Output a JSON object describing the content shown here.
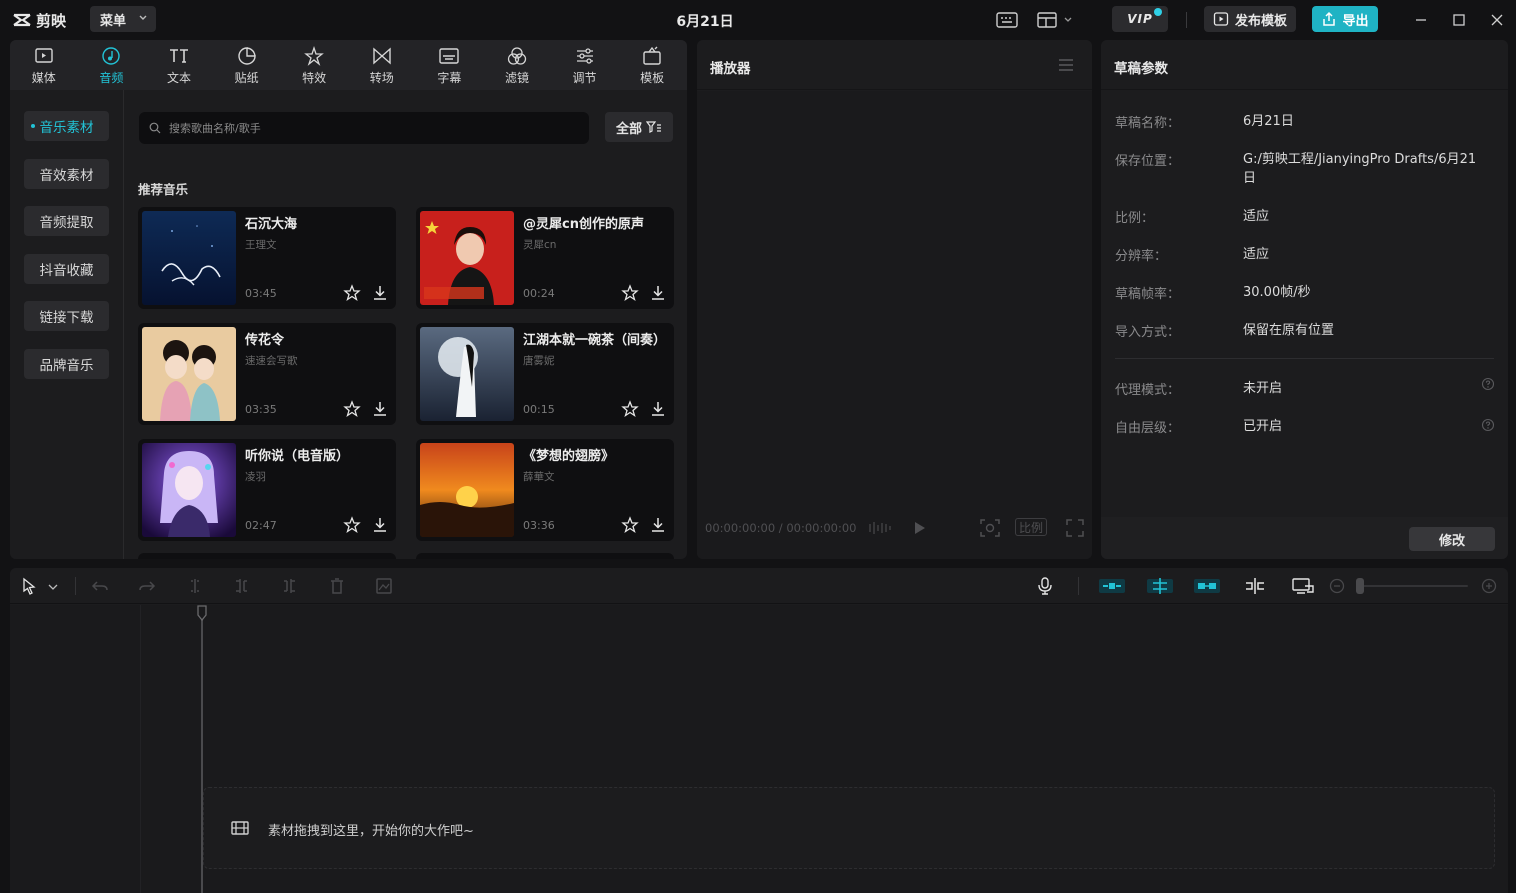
{
  "app": {
    "name": "剪映",
    "menu_label": "菜单",
    "window_title": "6月21日",
    "vip_label": "VIP",
    "publish_label": "发布模板",
    "export_label": "导出"
  },
  "categories": [
    {
      "label": "媒体",
      "icon": "media-icon",
      "active": false
    },
    {
      "label": "音频",
      "icon": "audio-icon",
      "active": true
    },
    {
      "label": "文本",
      "icon": "text-icon",
      "active": false
    },
    {
      "label": "贴纸",
      "icon": "sticker-icon",
      "active": false
    },
    {
      "label": "特效",
      "icon": "effects-icon",
      "active": false
    },
    {
      "label": "转场",
      "icon": "transition-icon",
      "active": false
    },
    {
      "label": "字幕",
      "icon": "subtitle-icon",
      "active": false
    },
    {
      "label": "滤镜",
      "icon": "filter-icon",
      "active": false
    },
    {
      "label": "调节",
      "icon": "adjust-icon",
      "active": false
    },
    {
      "label": "模板",
      "icon": "template-icon",
      "active": false
    }
  ],
  "subnav": [
    {
      "label": "音乐素材",
      "active": true
    },
    {
      "label": "音效素材",
      "active": false
    },
    {
      "label": "音频提取",
      "active": false
    },
    {
      "label": "抖音收藏",
      "active": false
    },
    {
      "label": "链接下载",
      "active": false
    },
    {
      "label": "品牌音乐",
      "active": false
    }
  ],
  "search": {
    "placeholder": "搜索歌曲名称/歌手"
  },
  "filter_label": "全部",
  "section_title": "推荐音乐",
  "songs": [
    {
      "title": "石沉大海",
      "artist": "王理文",
      "duration": "03:45"
    },
    {
      "title": "@灵犀cn创作的原声",
      "artist": "灵犀cn",
      "duration": "00:24"
    },
    {
      "title": "传花令",
      "artist": "速速会写歌",
      "duration": "03:35"
    },
    {
      "title": "江湖本就一碗茶（间奏）",
      "artist": "唐雾妮",
      "duration": "00:15"
    },
    {
      "title": "听你说（电音版）",
      "artist": "凌羽",
      "duration": "02:47"
    },
    {
      "title": "《梦想的翅膀》",
      "artist": "薛華文",
      "duration": "03:36"
    }
  ],
  "player": {
    "title": "播放器",
    "timecode": "00:00:00:00 / 00:00:00:00",
    "ratio_label": "比例"
  },
  "draft": {
    "title": "草稿参数",
    "params": [
      {
        "label": "草稿名称：",
        "value": "6月21日"
      },
      {
        "label": "保存位置：",
        "value": "G:/剪映工程/JianyingPro Drafts/6月21日"
      },
      {
        "label": "比例：",
        "value": "适应"
      },
      {
        "label": "分辨率：",
        "value": "适应"
      },
      {
        "label": "草稿帧率：",
        "value": "30.00帧/秒"
      },
      {
        "label": "导入方式：",
        "value": "保留在原有位置"
      }
    ],
    "params2": [
      {
        "label": "代理模式：",
        "value": "未开启"
      },
      {
        "label": "自由层级：",
        "value": "已开启"
      }
    ],
    "modify_label": "修改"
  },
  "timeline": {
    "drop_hint": "素材拖拽到这里，开始你的大作吧~"
  },
  "colors": {
    "accent": "#22c3d6",
    "export": "#1fb3c4",
    "bg": "#121214",
    "panel": "#1c1c1e"
  }
}
